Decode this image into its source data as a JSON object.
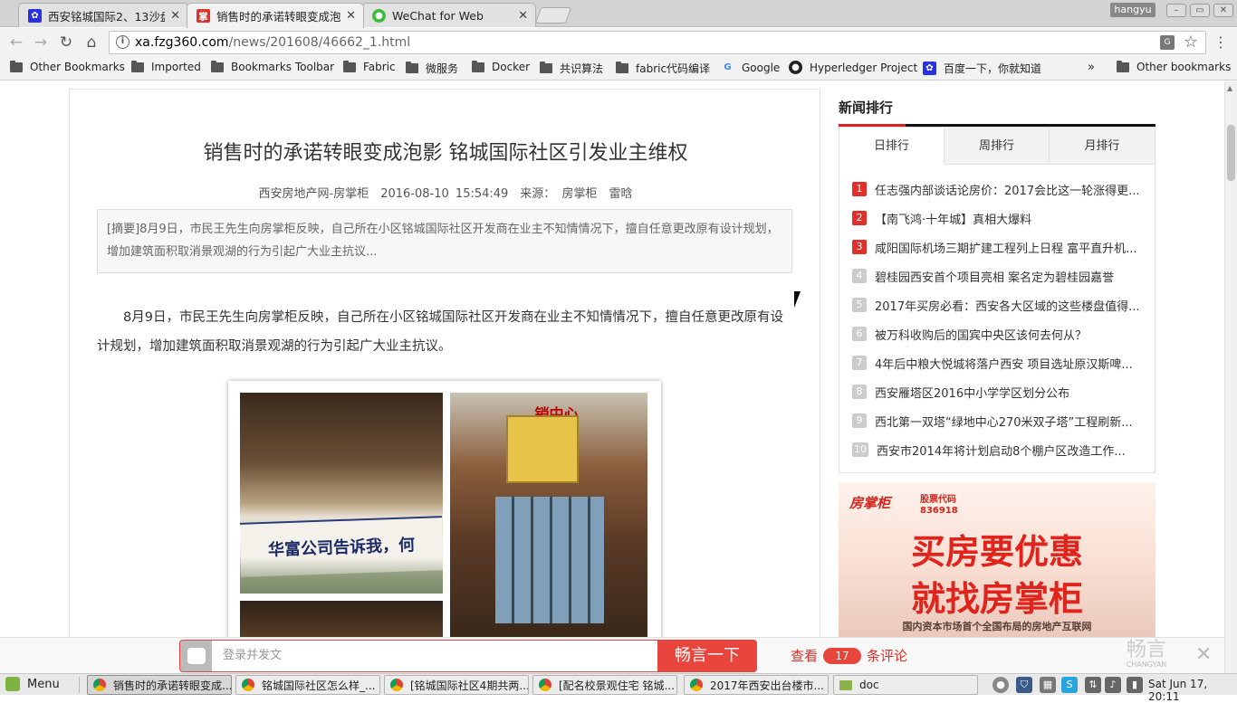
{
  "browser": {
    "tabs": [
      {
        "title": "西安铭城国际2、13沙盘",
        "icon": "paw-icon",
        "active": false
      },
      {
        "title": "销售时的承诺转眼变成泡",
        "icon": "zhang-icon",
        "active": true
      },
      {
        "title": "WeChat for Web",
        "icon": "wechat-icon",
        "active": false
      }
    ],
    "user": "hangyu",
    "url_host": "xa.fzg360.com",
    "url_path": "/news/201608/46662_1.html"
  },
  "bookmarks": [
    {
      "label": "Other Bookmarks",
      "icon": "folder-icon"
    },
    {
      "label": "Imported",
      "icon": "folder-icon"
    },
    {
      "label": "Bookmarks Toolbar",
      "icon": "folder-icon"
    },
    {
      "label": "Fabric",
      "icon": "folder-icon"
    },
    {
      "label": "微服务",
      "icon": "folder-icon"
    },
    {
      "label": "Docker",
      "icon": "folder-icon"
    },
    {
      "label": "共识算法",
      "icon": "folder-icon"
    },
    {
      "label": "fabric代码编译",
      "icon": "folder-icon"
    },
    {
      "label": "Google",
      "icon": "google-icon"
    },
    {
      "label": "Hyperledger Project",
      "icon": "github-icon"
    },
    {
      "label": "百度一下，你就知道",
      "icon": "paw-icon"
    },
    {
      "label": "»",
      "icon": "overflow-chevron"
    },
    {
      "label": "Other bookmarks",
      "icon": "folder-icon"
    }
  ],
  "article": {
    "title": "销售时的承诺转眼变成泡影 铭城国际社区引发业主维权",
    "meta": "西安房地产网-房掌柜　2016-08-10 15:54:49　来源：  房掌柜　雷晗",
    "summary": "[摘要]8月9日，市民王先生向房掌柜反映，自己所在小区铭城国际社区开发商在业主不知情情况下，擅自任意更改原有设计规划，增加建筑面积取消景观湖的行为引起广大业主抗议...",
    "body": "8月9日，市民王先生向房掌柜反映，自己所在小区铭城国际社区开发商在业主不知情情况下，擅自任意更改原有设计规划，增加建筑面积取消景观湖的行为引起广大业主抗议。",
    "photo_banner": "华富公司告诉我，何",
    "photo_sign": "销中心"
  },
  "sidebar": {
    "rank_title": "新闻排行",
    "tabs": [
      "日排行",
      "周排行",
      "月排行"
    ],
    "items": [
      {
        "num": "1",
        "text": "任志强内部谈话论房价：2017会比这一轮涨得更..."
      },
      {
        "num": "2",
        "text": "【南飞鸿·十年城】真相大爆料"
      },
      {
        "num": "3",
        "text": "咸阳国际机场三期扩建工程列上日程 富平直升机..."
      },
      {
        "num": "4",
        "text": "碧桂园西安首个项目亮相 案名定为碧桂园嘉誉"
      },
      {
        "num": "5",
        "text": "2017年买房必看：西安各大区域的这些楼盘值得..."
      },
      {
        "num": "6",
        "text": "被万科收购后的国宾中央区该何去何从？"
      },
      {
        "num": "7",
        "text": "4年后中粮大悦城将落户西安 项目选址原汉斯啤..."
      },
      {
        "num": "8",
        "text": "西安雁塔区2016中小学学区划分公布"
      },
      {
        "num": "9",
        "text": "西北第一双塔“绿地中心270米双子塔”工程刷新..."
      },
      {
        "num": "10",
        "text": "西安市2014年将计划启动8个棚户区改造工作..."
      }
    ],
    "ad": {
      "brand": "房掌柜",
      "code_label": "股票代码",
      "code": "836918",
      "line1": "买房要优惠",
      "line2": "就找房掌柜",
      "tagline": "国内资本市场首个全国布局的房地产互联网"
    }
  },
  "comment_bar": {
    "placeholder": "登录并发文",
    "submit": "畅言一下",
    "view_prefix": "查看",
    "count": "17",
    "view_suffix": "条评论",
    "logo": "畅言",
    "logo_sub": "CHANGYAN"
  },
  "taskbar": {
    "menu": "Menu",
    "tasks": [
      {
        "label": "销售时的承诺转眼变成...",
        "icon": "chrome-icon"
      },
      {
        "label": "铭城国际社区怎么样_...",
        "icon": "chrome-icon"
      },
      {
        "label": "[铭城国际社区4期共两...",
        "icon": "chrome-icon"
      },
      {
        "label": "[配名校景观住宅 铭城...",
        "icon": "chrome-icon"
      },
      {
        "label": "2017年西安出台楼市...",
        "icon": "chrome-icon"
      },
      {
        "label": "doc",
        "icon": "folder-icon"
      }
    ],
    "clock": "Sat Jun 17, 20:11"
  }
}
